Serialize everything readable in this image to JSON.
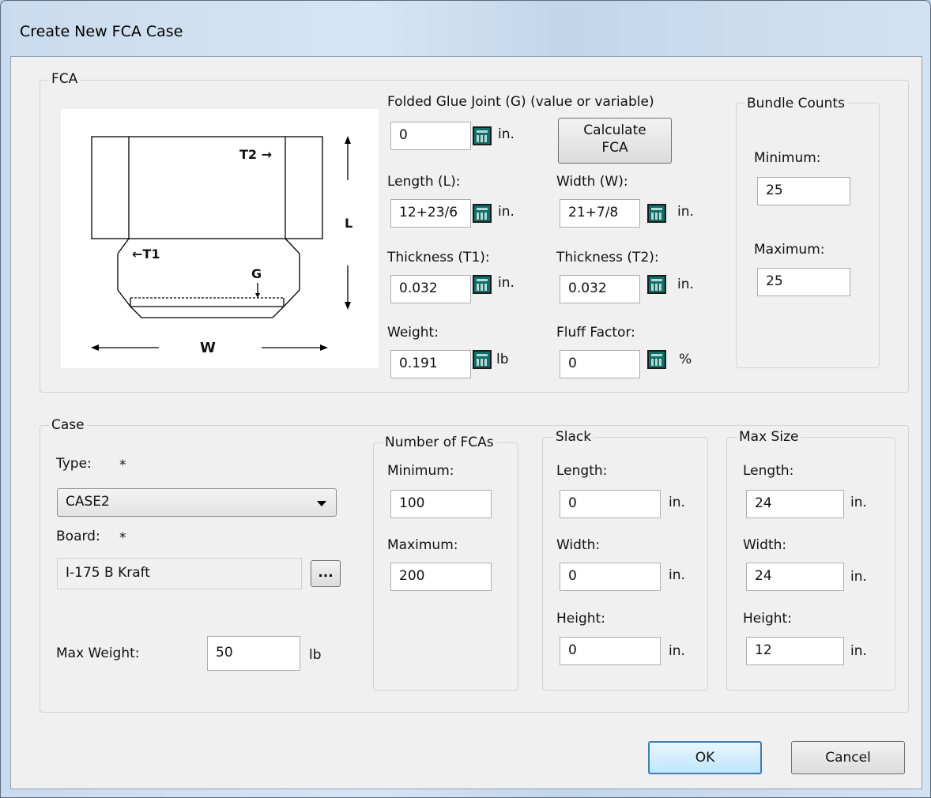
{
  "window": {
    "title": "Create New FCA Case"
  },
  "fca": {
    "group_label": "FCA",
    "diagram": {
      "t2": "T2 →",
      "t1": "←T1",
      "g": "G",
      "l": "L",
      "w": "W"
    },
    "glue_joint": {
      "label": "Folded Glue Joint (G) (value or variable)",
      "value": "0",
      "unit": "in."
    },
    "calculate_label": "Calculate\nFCA",
    "length": {
      "label": "Length (L):",
      "value": "12+23/6",
      "unit": "in."
    },
    "width": {
      "label": "Width (W):",
      "value": "21+7/8",
      "unit": "in."
    },
    "thickness_t1": {
      "label": "Thickness (T1):",
      "value": "0.032",
      "unit": "in."
    },
    "thickness_t2": {
      "label": "Thickness (T2):",
      "value": "0.032",
      "unit": "in."
    },
    "weight": {
      "label": "Weight:",
      "value": "0.191",
      "unit": "lb"
    },
    "fluff": {
      "label": "Fluff Factor:",
      "value": "0",
      "unit": "%"
    }
  },
  "bundle_counts": {
    "group_label": "Bundle Counts",
    "minimum": {
      "label": "Minimum:",
      "value": "25"
    },
    "maximum": {
      "label": "Maximum:",
      "value": "25"
    }
  },
  "case": {
    "group_label": "Case",
    "type": {
      "label": "Type:",
      "required_mark": "*",
      "value": "CASE2"
    },
    "board": {
      "label": "Board:",
      "required_mark": "*",
      "value": "I-175 B Kraft",
      "browse_label": "..."
    },
    "max_weight": {
      "label": "Max Weight:",
      "value": "50",
      "unit": "lb"
    }
  },
  "number_of_fcas": {
    "group_label": "Number of FCAs",
    "minimum": {
      "label": "Minimum:",
      "value": "100"
    },
    "maximum": {
      "label": "Maximum:",
      "value": "200"
    }
  },
  "slack": {
    "group_label": "Slack",
    "length": {
      "label": "Length:",
      "value": "0",
      "unit": "in."
    },
    "width": {
      "label": "Width:",
      "value": "0",
      "unit": "in."
    },
    "height": {
      "label": "Height:",
      "value": "0",
      "unit": "in."
    }
  },
  "max_size": {
    "group_label": "Max Size",
    "length": {
      "label": "Length:",
      "value": "24",
      "unit": "in."
    },
    "width": {
      "label": "Width:",
      "value": "24",
      "unit": "in."
    },
    "height": {
      "label": "Height:",
      "value": "12",
      "unit": "in."
    }
  },
  "buttons": {
    "ok": "OK",
    "cancel": "Cancel"
  },
  "icons": {
    "calculator": "calculator-icon",
    "dropdown": "chevron-down-icon"
  }
}
